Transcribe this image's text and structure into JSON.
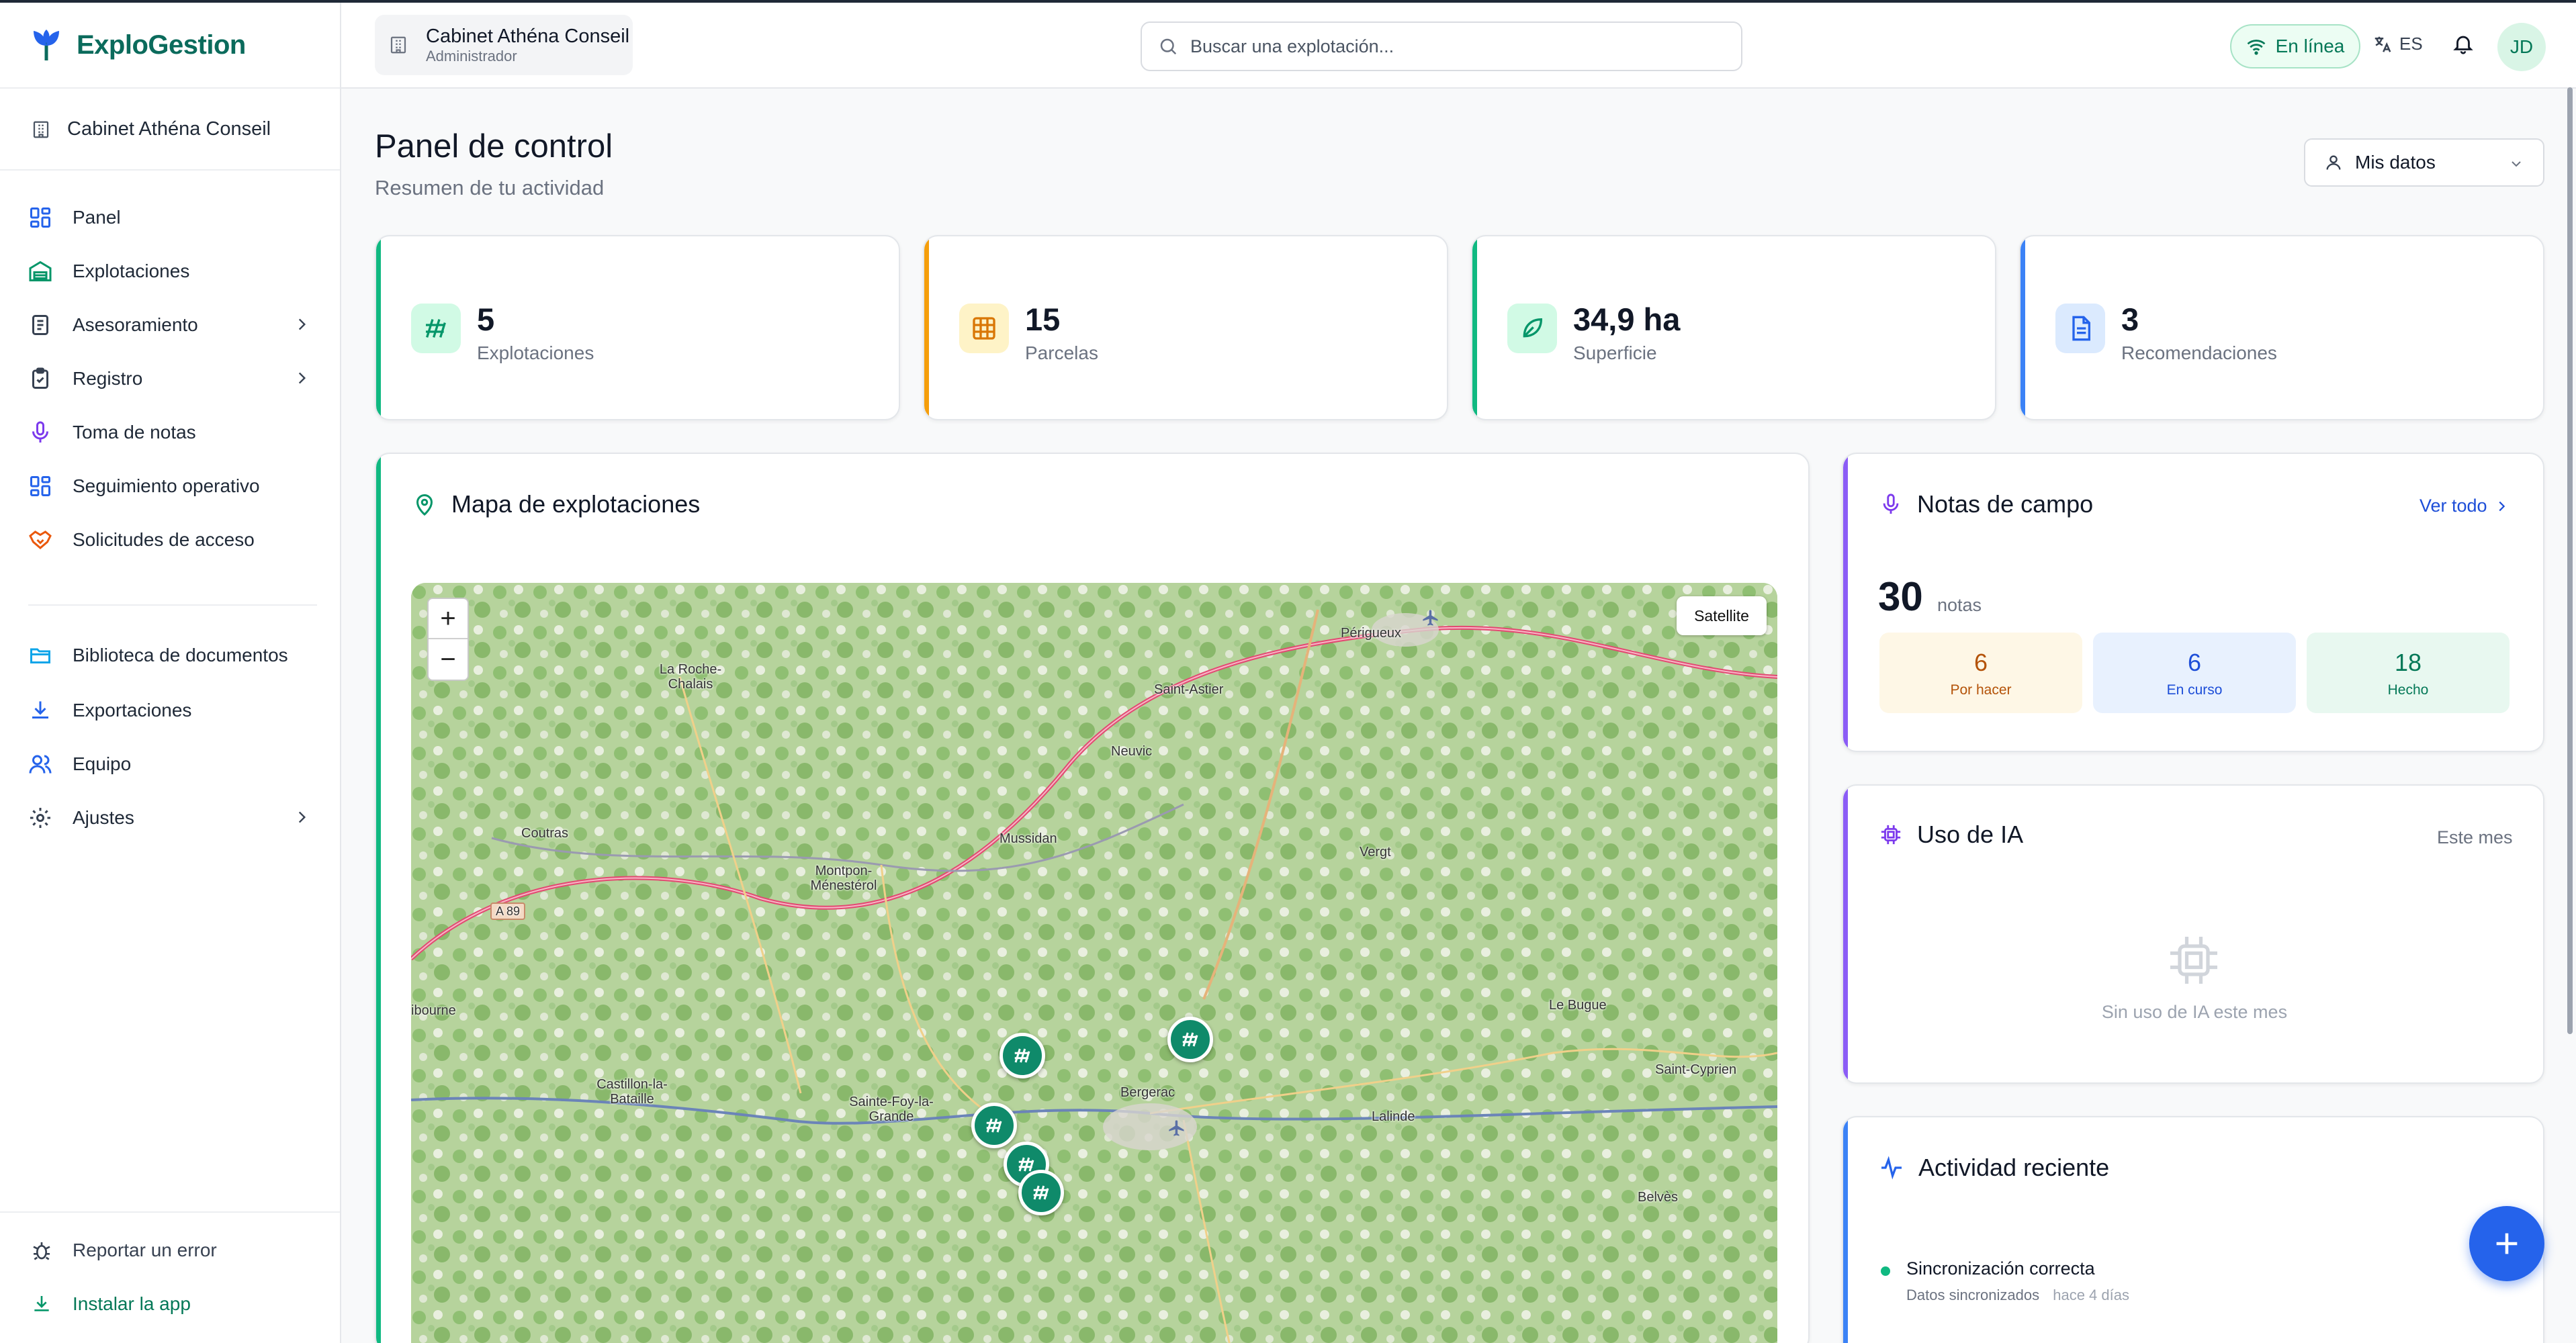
{
  "app": {
    "name": "ExploGestion"
  },
  "sidebar": {
    "organization": "Cabinet Athéna Conseil",
    "items": [
      {
        "label": "Panel"
      },
      {
        "label": "Explotaciones"
      },
      {
        "label": "Asesoramiento"
      },
      {
        "label": "Registro"
      },
      {
        "label": "Toma de notas"
      },
      {
        "label": "Seguimiento operativo"
      },
      {
        "label": "Solicitudes de acceso"
      },
      {
        "label": "Biblioteca de documentos"
      },
      {
        "label": "Exportaciones"
      },
      {
        "label": "Equipo"
      },
      {
        "label": "Ajustes"
      }
    ],
    "report_bug": "Reportar un error",
    "install_app": "Instalar la app"
  },
  "header": {
    "workspace_name": "Cabinet Athéna Conseil",
    "workspace_role": "Administrador",
    "search_placeholder": "Buscar una explotación...",
    "status": "En línea",
    "language": "ES",
    "avatar_initials": "JD"
  },
  "page": {
    "title": "Panel de control",
    "subtitle": "Resumen de tu actividad",
    "filter": "Mis datos"
  },
  "stats": [
    {
      "value": "5",
      "label": "Explotaciones",
      "color": "#10b981"
    },
    {
      "value": "15",
      "label": "Parcelas",
      "color": "#f59e0b"
    },
    {
      "value": "34,9 ha",
      "label": "Superficie",
      "color": "#10b981"
    },
    {
      "value": "3",
      "label": "Recomendaciones",
      "color": "#3b82f6"
    }
  ],
  "map": {
    "title": "Mapa de explotaciones",
    "layer_button": "Satellite",
    "zoom_in": "+",
    "zoom_out": "−",
    "towns": [
      "Périgueux",
      "La Roche-Chalais",
      "Saint-Astier",
      "Neuvic",
      "Coutras",
      "Mussidan",
      "Montpon-Ménestérol",
      "Vergt",
      "A 89",
      "ibourne",
      "Le Bugue",
      "Castillon-la-Bataille",
      "Sainte-Foy-la-Grande",
      "Bergerac",
      "Lalinde",
      "Saint-Cyprien",
      "Belvès"
    ]
  },
  "notes": {
    "title": "Notas de campo",
    "see_all": "Ver todo",
    "count": "30",
    "unit": "notas",
    "todo_value": "6",
    "todo_label": "Por hacer",
    "progress_value": "6",
    "progress_label": "En curso",
    "done_value": "18",
    "done_label": "Hecho"
  },
  "ai": {
    "title": "Uso de IA",
    "period": "Este mes",
    "empty": "Sin uso de IA este mes"
  },
  "activity": {
    "title": "Actividad reciente",
    "items": [
      {
        "title": "Sincronización correcta",
        "detail": "Datos sincronizados",
        "time": "hace 4 días"
      }
    ]
  },
  "colors": {
    "brand": "#0b6b5c",
    "primary": "#2563eb",
    "success": "#10b981",
    "warning": "#f59e0b",
    "purple": "#7c3aed"
  }
}
